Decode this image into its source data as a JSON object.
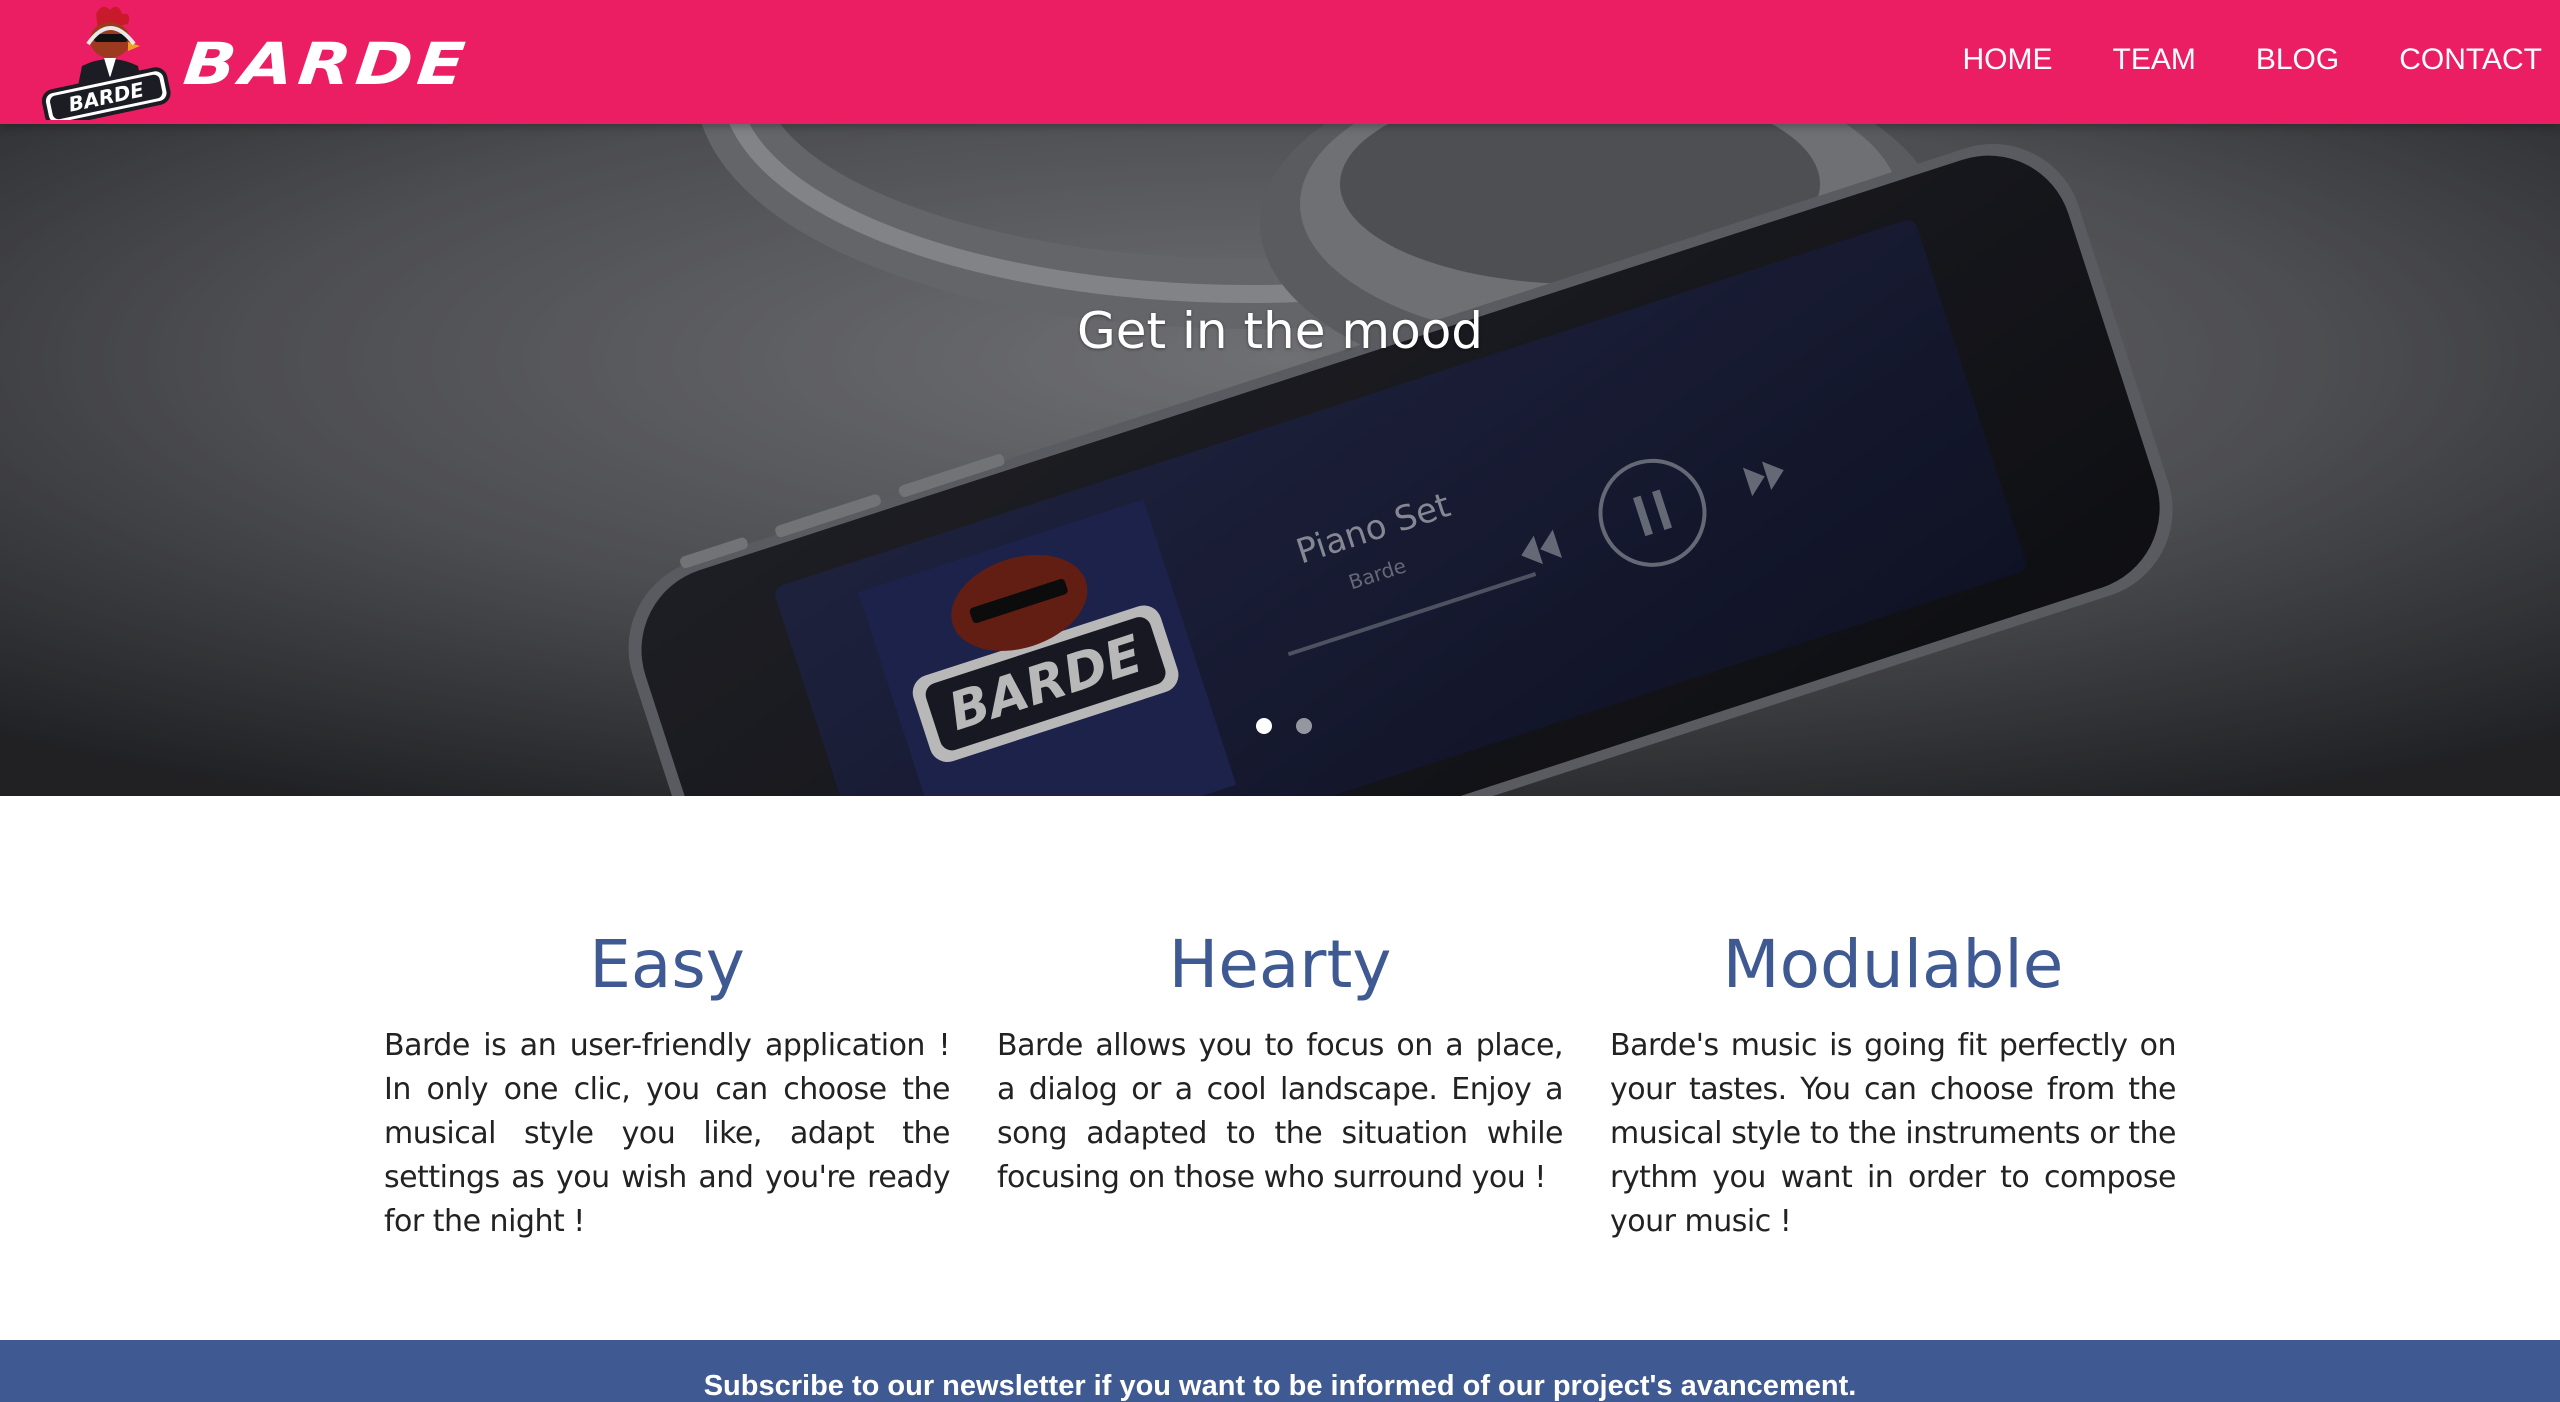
{
  "brand": {
    "name": "BARDE",
    "logo_text": "BARDE",
    "logo_icon": "rooster-mascot-icon"
  },
  "nav": {
    "links": [
      "HOME",
      "TEAM",
      "BLOG",
      "CONTACT"
    ]
  },
  "hero": {
    "caption": "Get in the mood",
    "slide_count": 2,
    "active_slide": 1,
    "phone_screen": {
      "logo_text": "BARDE",
      "track_title": "Piano Set",
      "artist": "Barde"
    }
  },
  "features": [
    {
      "title": "Easy",
      "text": "Barde is an user-friendly application ! In only one clic, you can choose the musical style you like, adapt the settings as you wish and you're ready for the night !"
    },
    {
      "title": "Hearty",
      "text": "Barde allows you to focus on a place, a dialog or a cool landscape. Enjoy a song adapted to the situation while focusing on those who surround you !"
    },
    {
      "title": "Modulable",
      "text": "Barde's music is going fit perfectly on your tastes. You can choose from the musical style to the instruments or the rythm you want in order to compose your music !"
    }
  ],
  "newsletter": {
    "text": "Subscribe to our newsletter if you want to be informed of our project's avancement."
  },
  "colors": {
    "navbar": "#ec1e63",
    "accent_blue": "#3f5a92",
    "text": "#222222"
  }
}
